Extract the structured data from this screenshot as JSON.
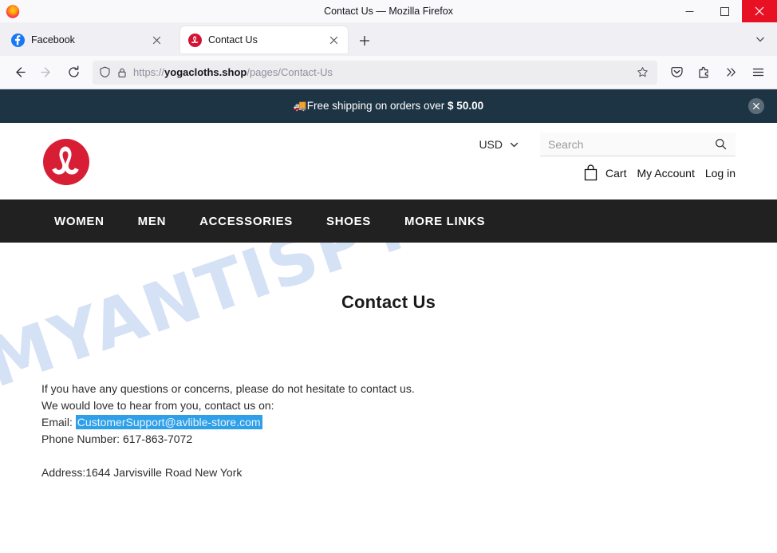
{
  "browser": {
    "window_title": "Contact Us — Mozilla Firefox",
    "app_icon": "firefox-logo",
    "window_controls": {
      "minimize": "minimize-icon",
      "maximize": "maximize-icon",
      "close": "close-icon"
    },
    "tabs": [
      {
        "label": "Facebook",
        "favicon": "facebook-favicon",
        "active": false,
        "close": "close-tab-icon"
      },
      {
        "label": "Contact Us",
        "favicon": "lululemon-favicon",
        "active": true,
        "close": "close-tab-icon"
      }
    ],
    "new_tab_label": "+",
    "tab_list_chevron": "chevron-down-icon",
    "toolbar": {
      "back": "back-arrow-icon",
      "forward": "forward-arrow-icon",
      "reload": "reload-icon",
      "shield": "shield-icon",
      "lock": "padlock-icon",
      "url_prefix": "https://",
      "url_domain": "yogacloths.shop",
      "url_path": "/pages/Contact-Us",
      "bookmark": "star-icon",
      "pocket": "pocket-icon",
      "extensions": "extensions-icon",
      "overflow": "double-chevron-icon",
      "app_menu": "hamburger-menu-icon"
    }
  },
  "page": {
    "watermark": "MYANTISPYWARE.COM",
    "announcement": {
      "emoji": "🚚",
      "text": "Free shipping on orders over ",
      "amount": "$ 50.00",
      "close": "close-icon",
      "bg_color": "#1d3444"
    },
    "header": {
      "logo": "lululemon-logo",
      "currency": {
        "value": "USD",
        "chevron": "chevron-down-icon"
      },
      "search": {
        "placeholder": "Search",
        "value": "",
        "icon": "search-icon"
      },
      "cart": {
        "label": "Cart",
        "icon": "shopping-bag-icon"
      },
      "account_label": "My Account",
      "login_label": "Log in"
    },
    "nav": {
      "bg_color": "#212121",
      "items": [
        {
          "label": "WOMEN"
        },
        {
          "label": "MEN"
        },
        {
          "label": "ACCESSORIES"
        },
        {
          "label": "SHOES"
        },
        {
          "label": "MORE LINKS"
        }
      ]
    },
    "content": {
      "title": "Contact Us",
      "line1": "If you have any questions or concerns, please do not hesitate to contact us.",
      "line2": "We would love to hear from you, contact us on:",
      "email_label": "Email: ",
      "email_value": "CustomerSupport@avlible-store.com",
      "email_selected": true,
      "phone_line": "Phone Number: 617-863-7072",
      "address_line": "Address:1644 Jarvisville Road New York"
    }
  }
}
